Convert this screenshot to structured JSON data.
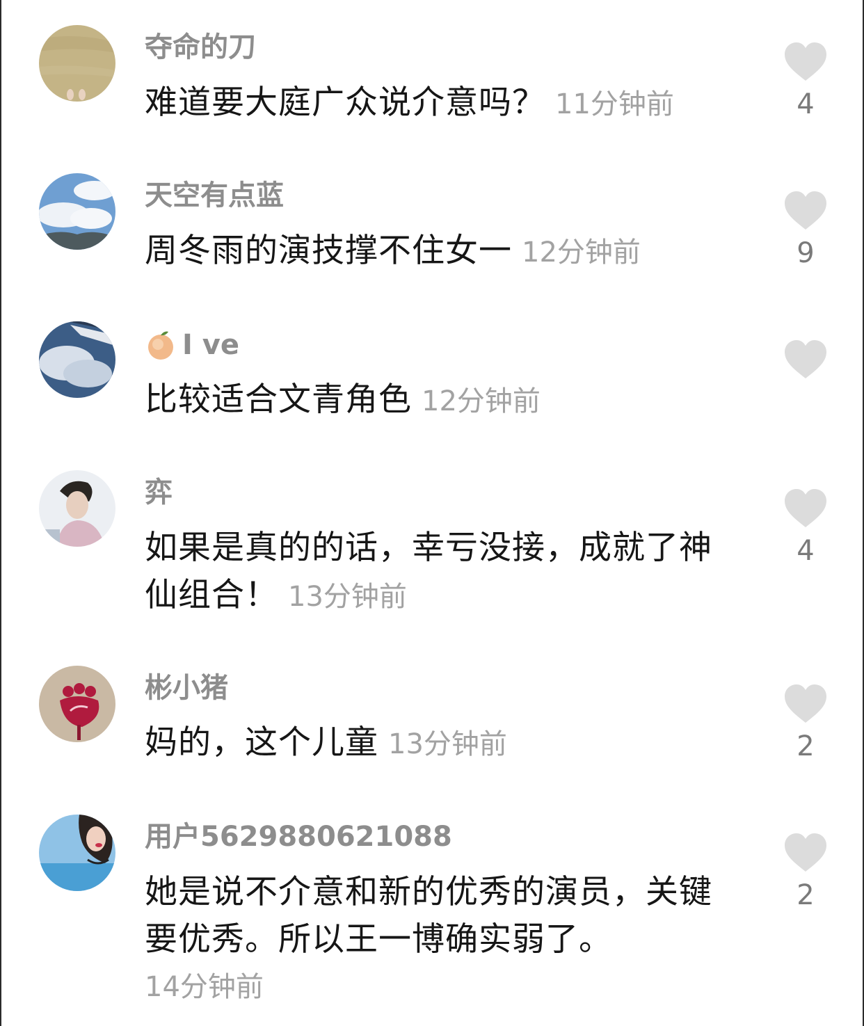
{
  "comments": [
    {
      "username": "夺命的刀",
      "text": "难道要大庭广众说介意吗？",
      "time": "11分钟前",
      "likes": "4"
    },
    {
      "username": "天空有点蓝",
      "text": "周冬雨的演技撑不住女一",
      "time": "12分钟前",
      "likes": "9"
    },
    {
      "username": "I ve",
      "text": "比较适合文青角色",
      "time": "12分钟前",
      "likes": ""
    },
    {
      "username": "弈",
      "text": "如果是真的的话，幸亏没接，成就了神仙组合！",
      "time": "13分钟前",
      "likes": "4"
    },
    {
      "username": "彬小猪",
      "text": "妈的，这个儿童",
      "time": "13分钟前",
      "likes": "2"
    },
    {
      "username": "用户5629880621088",
      "text": "她是说不介意和新的优秀的演员，关键要优秀。所以王一博确实弱了。",
      "time": "14分钟前",
      "likes": "2"
    }
  ],
  "icons": {
    "like": "heart-icon",
    "emoji": "peach-emoji"
  },
  "colors": {
    "username": "#8d8d8d",
    "text": "#161616",
    "time": "#a2a2a2",
    "heart": "#dcdcdc"
  }
}
